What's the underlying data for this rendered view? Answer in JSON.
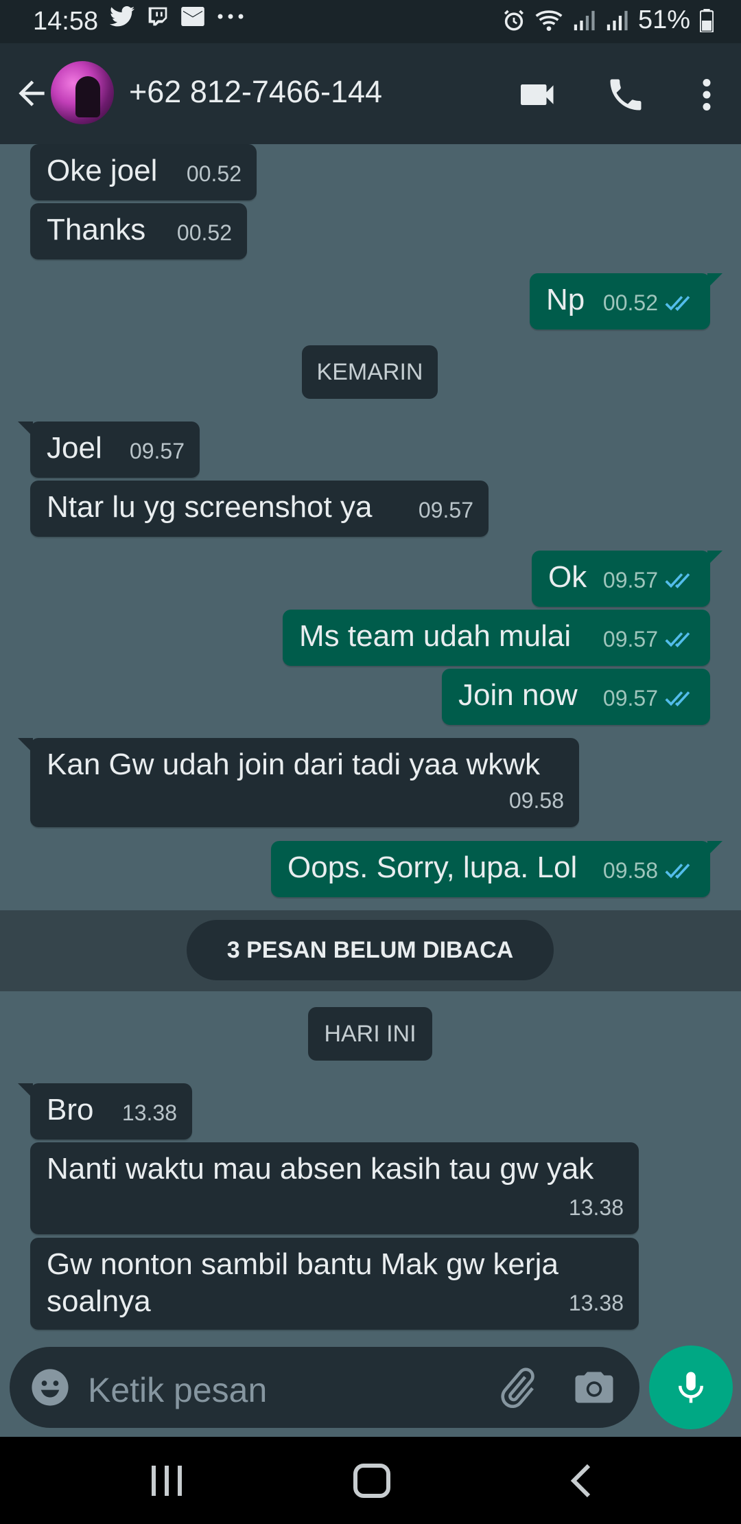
{
  "status_bar": {
    "time": "14:58",
    "battery": "51%",
    "notification_icons": [
      "twitter-icon",
      "twitch-icon",
      "mail-icon",
      "more-dots-icon"
    ],
    "system_icons": [
      "alarm-icon",
      "wifi-icon",
      "signal-icon",
      "signal-icon",
      "battery-icon"
    ]
  },
  "header": {
    "contact": "+62 812-7466-144",
    "icons": [
      "back-arrow-icon",
      "avatar",
      "video-call-icon",
      "voice-call-icon",
      "more-vert-icon"
    ]
  },
  "messages": [
    {
      "dir": "in",
      "text": "Oke joel",
      "time": "00.52"
    },
    {
      "dir": "in",
      "text": "Thanks",
      "time": "00.52"
    },
    {
      "dir": "out",
      "text": "Np",
      "time": "00.52",
      "read": true
    },
    {
      "dir": "in",
      "text": "Joel",
      "time": "09.57"
    },
    {
      "dir": "in",
      "text": "Ntar lu yg screenshot ya",
      "time": "09.57"
    },
    {
      "dir": "out",
      "text": "Ok",
      "time": "09.57",
      "read": true
    },
    {
      "dir": "out",
      "text": "Ms team udah mulai",
      "time": "09.57",
      "read": true
    },
    {
      "dir": "out",
      "text": "Join now",
      "time": "09.57",
      "read": true
    },
    {
      "dir": "in",
      "text": "Kan Gw udah join dari tadi yaa wkwk",
      "time": "09.58"
    },
    {
      "dir": "out",
      "text": "Oops. Sorry, lupa. Lol",
      "time": "09.58",
      "read": true
    },
    {
      "dir": "in",
      "text": "Bro",
      "time": "13.38"
    },
    {
      "dir": "in",
      "text": "Nanti waktu mau absen kasih tau gw yak",
      "time": "13.38"
    },
    {
      "dir": "in",
      "text": "Gw nonton sambil bantu Mak gw kerja soalnya",
      "time": "13.38"
    }
  ],
  "date_chips": {
    "yesterday": "KEMARIN",
    "today": "HARI INI"
  },
  "unread_banner": "3 PESAN BELUM DIBACA",
  "composer": {
    "placeholder": "Ketik pesan",
    "icons": [
      "emoji-icon",
      "attach-icon",
      "camera-icon",
      "mic-icon"
    ]
  },
  "colors": {
    "chat_background": "#4c636c",
    "incoming_bubble": "#202c33",
    "outgoing_bubble": "#005c4b",
    "read_tick": "#53bdeb",
    "mic_button": "#00a884"
  }
}
